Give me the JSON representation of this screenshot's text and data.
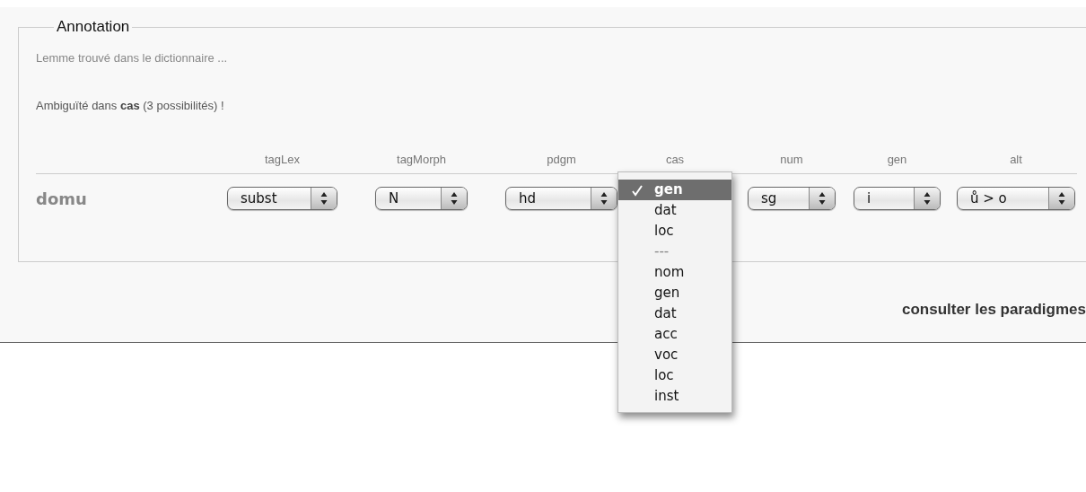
{
  "legend": "Annotation",
  "messages": [
    {
      "kind": "info",
      "text": "Lemme trouvé dans le dictionnaire ..."
    },
    {
      "kind": "warning",
      "text": "Ambiguïté dans **cas** (3 possibilités) !"
    }
  ],
  "table": {
    "columns": [
      "tagLex",
      "tagMorph",
      "pdgm",
      "cas",
      "num",
      "gen",
      "alt"
    ],
    "rows": [
      {
        "word": "domu",
        "cells": [
          {
            "open": false,
            "value": "subst"
          },
          {
            "open": false,
            "value": "N"
          },
          {
            "open": false,
            "value": "hd"
          },
          {
            "open": true,
            "options": [
              {
                "kind": "option",
                "label": "gen",
                "selected": true
              },
              {
                "kind": "option",
                "label": "dat",
                "selected": false
              },
              {
                "kind": "option",
                "label": "loc",
                "selected": false
              },
              {
                "kind": "separator",
                "label": "---",
                "selected": false
              },
              {
                "kind": "option",
                "label": "nom",
                "selected": false
              },
              {
                "kind": "option",
                "label": "gen",
                "selected": false
              },
              {
                "kind": "option",
                "label": "dat",
                "selected": false
              },
              {
                "kind": "option",
                "label": "acc",
                "selected": false
              },
              {
                "kind": "option",
                "label": "voc",
                "selected": false
              },
              {
                "kind": "option",
                "label": "loc",
                "selected": false
              },
              {
                "kind": "option",
                "label": "inst",
                "selected": false
              }
            ]
          },
          {
            "open": false,
            "value": "sg"
          },
          {
            "open": false,
            "value": "i"
          },
          {
            "open": false,
            "value": "ů > o"
          }
        ]
      }
    ]
  },
  "link": "consulter les paradigmes"
}
